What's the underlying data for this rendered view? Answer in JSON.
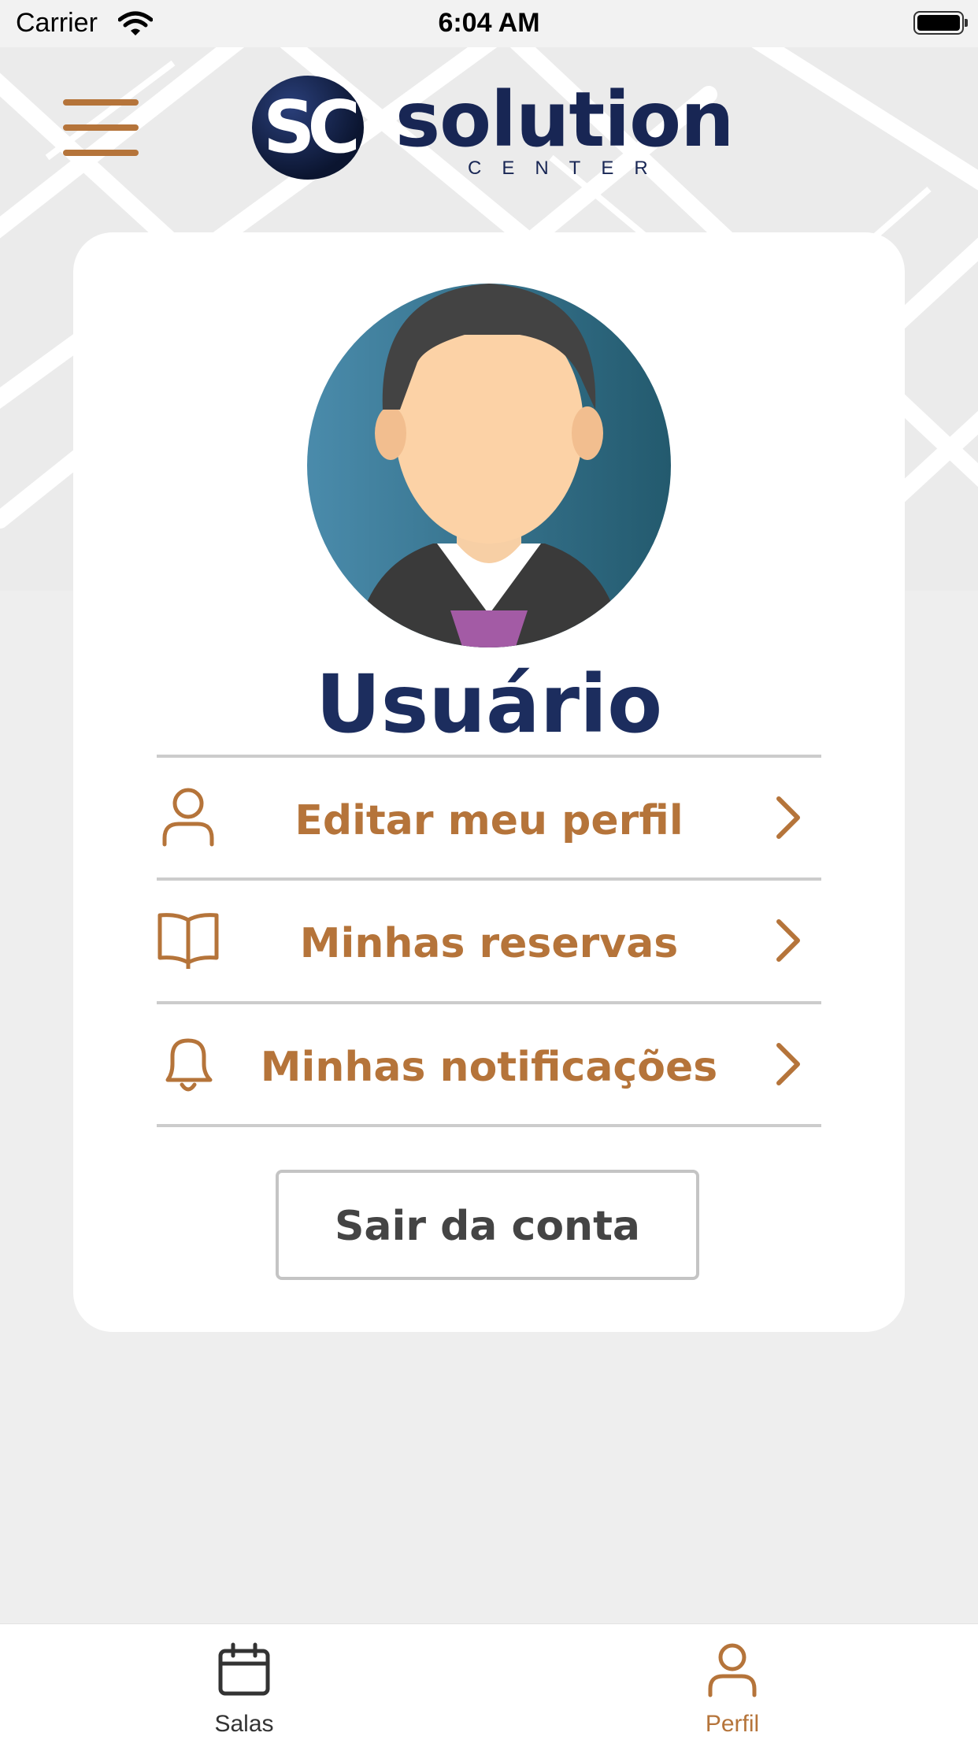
{
  "status_bar": {
    "carrier": "Carrier",
    "time": "6:04 AM"
  },
  "header": {
    "logo_mark": "SC",
    "logo_word": "solution",
    "logo_sub": "CENTER"
  },
  "profile": {
    "name": "Usuário"
  },
  "menu": {
    "items": [
      {
        "label": "Editar meu perfil",
        "icon": "user-icon"
      },
      {
        "label": "Minhas reservas",
        "icon": "book-icon"
      },
      {
        "label": "Minhas notificações",
        "icon": "bell-icon"
      }
    ]
  },
  "logout": {
    "label": "Sair da conta"
  },
  "tabs": [
    {
      "label": "Salas",
      "icon": "calendar-icon",
      "active": false
    },
    {
      "label": "Perfil",
      "icon": "user-icon",
      "active": true
    }
  ],
  "colors": {
    "accent": "#b5743a",
    "primary_dark": "#1c2d5e",
    "tab_inactive": "#333333",
    "tab_active": "#b5743a"
  }
}
